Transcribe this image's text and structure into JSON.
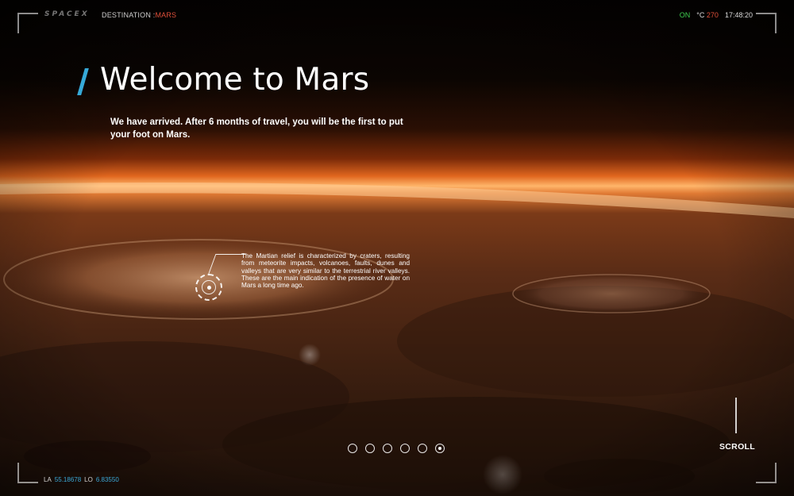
{
  "header": {
    "brand": "SPACEX",
    "destination_label": "DESTINATION :",
    "destination_value": "MARS",
    "status": {
      "on_label": "ON",
      "temp_unit": "°C",
      "temp_value": "270",
      "time": "17:48:20"
    }
  },
  "main": {
    "title": "Welcome to Mars",
    "intro": "We have arrived. After 6 months of travel, you will be the first to put your foot on Mars."
  },
  "annotation": {
    "text": "The Martian relief is characterized by craters, resulting from meteorite impacts, volcanoes, faults, dunes and valleys that are very similar to the terrestrial river valleys. These are the main indication of the presence of water on Mars a long time ago."
  },
  "pager": {
    "count": 6,
    "active_index": 5
  },
  "scroll": {
    "label": "SCROLL"
  },
  "coords": {
    "la_label": "LA",
    "la_value": "55.18678",
    "lo_label": "LO",
    "lo_value": "6.83550"
  },
  "colors": {
    "accent_blue": "#36a9d8",
    "accent_red": "#e0503a",
    "status_green": "#3fcf4f"
  }
}
